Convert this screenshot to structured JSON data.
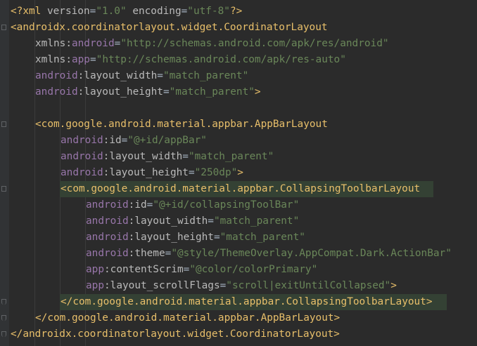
{
  "editor": {
    "lines": [
      {
        "indent": 0,
        "segs": [
          [
            "pi",
            "<?xml "
          ],
          [
            "piattr",
            "version"
          ],
          [
            "eq",
            "="
          ],
          [
            "val",
            "\"1.0\""
          ],
          [
            "pi",
            " "
          ],
          [
            "piattr",
            "encoding"
          ],
          [
            "eq",
            "="
          ],
          [
            "val",
            "\"utf-8\""
          ],
          [
            "pi",
            "?>"
          ]
        ]
      },
      {
        "indent": 0,
        "segs": [
          [
            "tag",
            "<androidx.coordinatorlayout.widget.CoordinatorLayout"
          ]
        ]
      },
      {
        "indent": 1,
        "segs": [
          [
            "attr",
            "xmlns:"
          ],
          [
            "ns",
            "android"
          ],
          [
            "eq",
            "="
          ],
          [
            "val",
            "\"http://schemas.android.com/apk/res/android\""
          ]
        ]
      },
      {
        "indent": 1,
        "segs": [
          [
            "attr",
            "xmlns:"
          ],
          [
            "ns",
            "app"
          ],
          [
            "eq",
            "="
          ],
          [
            "val",
            "\"http://schemas.android.com/apk/res-auto\""
          ]
        ]
      },
      {
        "indent": 1,
        "segs": [
          [
            "ns",
            "android"
          ],
          [
            "attr",
            ":layout_width"
          ],
          [
            "eq",
            "="
          ],
          [
            "val",
            "\"match_parent\""
          ]
        ]
      },
      {
        "indent": 1,
        "segs": [
          [
            "ns",
            "android"
          ],
          [
            "attr",
            ":layout_height"
          ],
          [
            "eq",
            "="
          ],
          [
            "val",
            "\"match_parent\""
          ],
          [
            "tag",
            ">"
          ]
        ]
      },
      {
        "indent": 0,
        "segs": []
      },
      {
        "indent": 1,
        "segs": [
          [
            "tag",
            "<com.google.android.material.appbar.AppBarLayout"
          ]
        ]
      },
      {
        "indent": 2,
        "segs": [
          [
            "ns",
            "android"
          ],
          [
            "attr",
            ":id"
          ],
          [
            "eq",
            "="
          ],
          [
            "val",
            "\"@+id/appBar\""
          ]
        ]
      },
      {
        "indent": 2,
        "segs": [
          [
            "ns",
            "android"
          ],
          [
            "attr",
            ":layout_width"
          ],
          [
            "eq",
            "="
          ],
          [
            "val",
            "\"match_parent\""
          ]
        ]
      },
      {
        "indent": 2,
        "segs": [
          [
            "ns",
            "android"
          ],
          [
            "attr",
            ":layout_height"
          ],
          [
            "eq",
            "="
          ],
          [
            "val",
            "\"250dp\""
          ],
          [
            "tag",
            ">"
          ]
        ]
      },
      {
        "indent": 2,
        "segs": [
          [
            "tag",
            "<com.google.android.material.appbar."
          ],
          [
            "tag",
            "CollapsingToolbarLayout"
          ]
        ],
        "highlight": true
      },
      {
        "indent": 3,
        "segs": [
          [
            "ns",
            "android"
          ],
          [
            "attr",
            ":id"
          ],
          [
            "eq",
            "="
          ],
          [
            "val",
            "\"@+id/collapsingToolBar\""
          ]
        ]
      },
      {
        "indent": 3,
        "segs": [
          [
            "ns",
            "android"
          ],
          [
            "attr",
            ":layout_width"
          ],
          [
            "eq",
            "="
          ],
          [
            "val",
            "\"match_parent\""
          ]
        ]
      },
      {
        "indent": 3,
        "segs": [
          [
            "ns",
            "android"
          ],
          [
            "attr",
            ":layout_height"
          ],
          [
            "eq",
            "="
          ],
          [
            "val",
            "\"match_parent\""
          ]
        ]
      },
      {
        "indent": 3,
        "segs": [
          [
            "ns",
            "android"
          ],
          [
            "attr",
            ":theme"
          ],
          [
            "eq",
            "="
          ],
          [
            "val",
            "\"@style/ThemeOverlay.AppCompat.Dark.ActionBar\""
          ]
        ]
      },
      {
        "indent": 3,
        "segs": [
          [
            "ns",
            "app"
          ],
          [
            "attr",
            ":contentScrim"
          ],
          [
            "eq",
            "="
          ],
          [
            "val",
            "\"@color/colorPrimary\""
          ]
        ]
      },
      {
        "indent": 3,
        "segs": [
          [
            "ns",
            "app"
          ],
          [
            "attr",
            ":layout_scrollFlags"
          ],
          [
            "eq",
            "="
          ],
          [
            "val",
            "\"scroll|exitUntilCollapsed\""
          ],
          [
            "tag",
            ">"
          ]
        ]
      },
      {
        "indent": 2,
        "segs": [
          [
            "tag",
            "</com.google.android.material.appbar."
          ],
          [
            "tag",
            "CollapsingToolbarLayout>"
          ]
        ],
        "highlight": true
      },
      {
        "indent": 1,
        "segs": [
          [
            "tag",
            "</com.google.android.material.appbar.AppBarLayout>"
          ]
        ]
      },
      {
        "indent": 0,
        "segs": [
          [
            "tag",
            "</androidx.coordinatorlayout.widget.CoordinatorLayout>"
          ]
        ]
      }
    ]
  },
  "colors": {
    "background": "#2b2b2b",
    "tag": "#e8bf6a",
    "namespace": "#9876aa",
    "attribute": "#bababa",
    "value": "#6a8759",
    "highlight": "#344134"
  }
}
